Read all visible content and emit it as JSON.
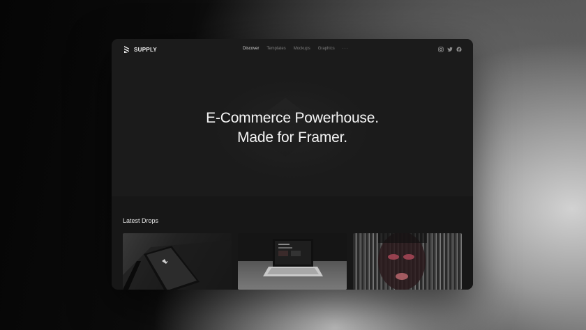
{
  "brand": {
    "name": "SUPPLY",
    "icon": "supply-logo-icon"
  },
  "nav": {
    "items": [
      {
        "label": "Discover",
        "active": true
      },
      {
        "label": "Templates",
        "active": false
      },
      {
        "label": "Mockups",
        "active": false
      },
      {
        "label": "Graphics",
        "active": false
      }
    ],
    "more_label": "···"
  },
  "socials": [
    "instagram-icon",
    "twitter-icon",
    "facebook-icon"
  ],
  "hero": {
    "line1": "E-Commerce Powerhouse.",
    "line2": "Made for Framer."
  },
  "drops": {
    "title": "Latest Drops",
    "cards": [
      {
        "name": "tablet-mockup-card"
      },
      {
        "name": "laptop-mockup-card"
      },
      {
        "name": "portrait-graphic-card"
      }
    ]
  },
  "colors": {
    "window_bg": "#1b1b1b",
    "section_bg": "#171717",
    "text_primary": "#f4f4f4",
    "nav_inactive": "#7d7d7d",
    "nav_active": "#d8d8d8"
  }
}
